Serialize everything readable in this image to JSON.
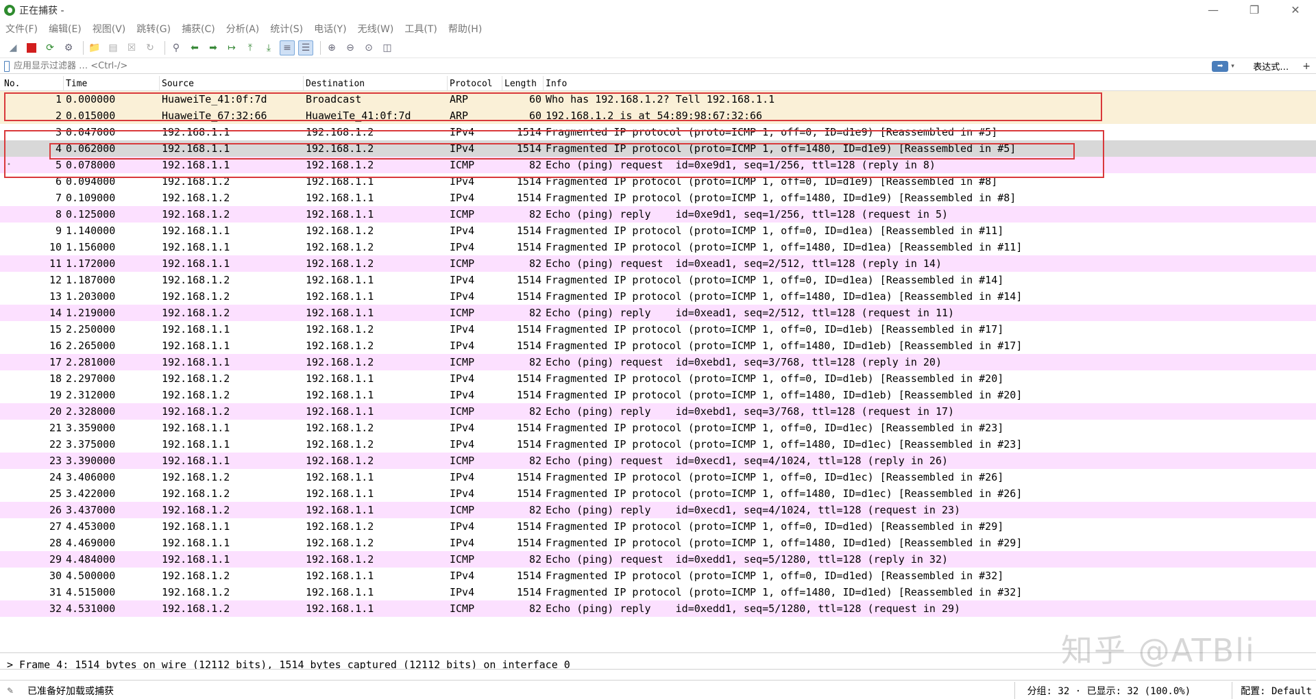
{
  "window": {
    "title": "正在捕获 -"
  },
  "menu": [
    "文件(F)",
    "编辑(E)",
    "视图(V)",
    "跳转(G)",
    "捕获(C)",
    "分析(A)",
    "统计(S)",
    "电话(Y)",
    "无线(W)",
    "工具(T)",
    "帮助(H)"
  ],
  "toolbar": {
    "icons": [
      "shark-fin-icon",
      "stop-icon",
      "restart-icon",
      "options-gear-icon",
      "open-folder-icon",
      "save-icon",
      "close-file-icon",
      "reload-icon",
      "find-icon",
      "back-arrow-icon",
      "forward-arrow-icon",
      "goto-packet-icon",
      "first-packet-icon",
      "last-packet-icon",
      "autoscroll-icon",
      "colorize-icon",
      "zoom-in-icon",
      "zoom-out-icon",
      "zoom-normal-icon",
      "resize-columns-icon"
    ]
  },
  "filter": {
    "placeholder": "应用显示过滤器 … <Ctrl-/>",
    "apply_arrow": "➡",
    "dropdown": "▾",
    "expression_label": "表达式…",
    "add_label": "+"
  },
  "columns": {
    "no": "No.",
    "time": "Time",
    "source": "Source",
    "destination": "Destination",
    "protocol": "Protocol",
    "length": "Length",
    "info": "Info"
  },
  "colors": {
    "arp": "#faf0d7",
    "icmp": "#fce0ff",
    "ipv4": "#ffffff",
    "selected": "#d8d8d8",
    "highlight_box": "#d9383a"
  },
  "packets": [
    {
      "no": "1",
      "time": "0.000000",
      "src": "HuaweiTe_41:0f:7d",
      "dst": "Broadcast",
      "proto": "ARP",
      "len": "60",
      "info": "Who has 192.168.1.2? Tell 192.168.1.1",
      "kind": "arp"
    },
    {
      "no": "2",
      "time": "0.015000",
      "src": "HuaweiTe_67:32:66",
      "dst": "HuaweiTe_41:0f:7d",
      "proto": "ARP",
      "len": "60",
      "info": "192.168.1.2 is at 54:89:98:67:32:66",
      "kind": "arp"
    },
    {
      "no": "3",
      "time": "0.047000",
      "src": "192.168.1.1",
      "dst": "192.168.1.2",
      "proto": "IPv4",
      "len": "1514",
      "info": "Fragmented IP protocol (proto=ICMP 1, off=0, ID=d1e9) [Reassembled in #5]",
      "kind": "ipv4"
    },
    {
      "no": "4",
      "time": "0.062000",
      "src": "192.168.1.1",
      "dst": "192.168.1.2",
      "proto": "IPv4",
      "len": "1514",
      "info": "Fragmented IP protocol (proto=ICMP 1, off=1480, ID=d1e9) [Reassembled in #5]",
      "kind": "selected"
    },
    {
      "no": "5",
      "time": "0.078000",
      "src": "192.168.1.1",
      "dst": "192.168.1.2",
      "proto": "ICMP",
      "len": "82",
      "info": "Echo (ping) request  id=0xe9d1, seq=1/256, ttl=128 (reply in 8)",
      "kind": "icmp"
    },
    {
      "no": "6",
      "time": "0.094000",
      "src": "192.168.1.2",
      "dst": "192.168.1.1",
      "proto": "IPv4",
      "len": "1514",
      "info": "Fragmented IP protocol (proto=ICMP 1, off=0, ID=d1e9) [Reassembled in #8]",
      "kind": "ipv4"
    },
    {
      "no": "7",
      "time": "0.109000",
      "src": "192.168.1.2",
      "dst": "192.168.1.1",
      "proto": "IPv4",
      "len": "1514",
      "info": "Fragmented IP protocol (proto=ICMP 1, off=1480, ID=d1e9) [Reassembled in #8]",
      "kind": "ipv4"
    },
    {
      "no": "8",
      "time": "0.125000",
      "src": "192.168.1.2",
      "dst": "192.168.1.1",
      "proto": "ICMP",
      "len": "82",
      "info": "Echo (ping) reply    id=0xe9d1, seq=1/256, ttl=128 (request in 5)",
      "kind": "icmp"
    },
    {
      "no": "9",
      "time": "1.140000",
      "src": "192.168.1.1",
      "dst": "192.168.1.2",
      "proto": "IPv4",
      "len": "1514",
      "info": "Fragmented IP protocol (proto=ICMP 1, off=0, ID=d1ea) [Reassembled in #11]",
      "kind": "ipv4"
    },
    {
      "no": "10",
      "time": "1.156000",
      "src": "192.168.1.1",
      "dst": "192.168.1.2",
      "proto": "IPv4",
      "len": "1514",
      "info": "Fragmented IP protocol (proto=ICMP 1, off=1480, ID=d1ea) [Reassembled in #11]",
      "kind": "ipv4"
    },
    {
      "no": "11",
      "time": "1.172000",
      "src": "192.168.1.1",
      "dst": "192.168.1.2",
      "proto": "ICMP",
      "len": "82",
      "info": "Echo (ping) request  id=0xead1, seq=2/512, ttl=128 (reply in 14)",
      "kind": "icmp"
    },
    {
      "no": "12",
      "time": "1.187000",
      "src": "192.168.1.2",
      "dst": "192.168.1.1",
      "proto": "IPv4",
      "len": "1514",
      "info": "Fragmented IP protocol (proto=ICMP 1, off=0, ID=d1ea) [Reassembled in #14]",
      "kind": "ipv4"
    },
    {
      "no": "13",
      "time": "1.203000",
      "src": "192.168.1.2",
      "dst": "192.168.1.1",
      "proto": "IPv4",
      "len": "1514",
      "info": "Fragmented IP protocol (proto=ICMP 1, off=1480, ID=d1ea) [Reassembled in #14]",
      "kind": "ipv4"
    },
    {
      "no": "14",
      "time": "1.219000",
      "src": "192.168.1.2",
      "dst": "192.168.1.1",
      "proto": "ICMP",
      "len": "82",
      "info": "Echo (ping) reply    id=0xead1, seq=2/512, ttl=128 (request in 11)",
      "kind": "icmp"
    },
    {
      "no": "15",
      "time": "2.250000",
      "src": "192.168.1.1",
      "dst": "192.168.1.2",
      "proto": "IPv4",
      "len": "1514",
      "info": "Fragmented IP protocol (proto=ICMP 1, off=0, ID=d1eb) [Reassembled in #17]",
      "kind": "ipv4"
    },
    {
      "no": "16",
      "time": "2.265000",
      "src": "192.168.1.1",
      "dst": "192.168.1.2",
      "proto": "IPv4",
      "len": "1514",
      "info": "Fragmented IP protocol (proto=ICMP 1, off=1480, ID=d1eb) [Reassembled in #17]",
      "kind": "ipv4"
    },
    {
      "no": "17",
      "time": "2.281000",
      "src": "192.168.1.1",
      "dst": "192.168.1.2",
      "proto": "ICMP",
      "len": "82",
      "info": "Echo (ping) request  id=0xebd1, seq=3/768, ttl=128 (reply in 20)",
      "kind": "icmp"
    },
    {
      "no": "18",
      "time": "2.297000",
      "src": "192.168.1.2",
      "dst": "192.168.1.1",
      "proto": "IPv4",
      "len": "1514",
      "info": "Fragmented IP protocol (proto=ICMP 1, off=0, ID=d1eb) [Reassembled in #20]",
      "kind": "ipv4"
    },
    {
      "no": "19",
      "time": "2.312000",
      "src": "192.168.1.2",
      "dst": "192.168.1.1",
      "proto": "IPv4",
      "len": "1514",
      "info": "Fragmented IP protocol (proto=ICMP 1, off=1480, ID=d1eb) [Reassembled in #20]",
      "kind": "ipv4"
    },
    {
      "no": "20",
      "time": "2.328000",
      "src": "192.168.1.2",
      "dst": "192.168.1.1",
      "proto": "ICMP",
      "len": "82",
      "info": "Echo (ping) reply    id=0xebd1, seq=3/768, ttl=128 (request in 17)",
      "kind": "icmp"
    },
    {
      "no": "21",
      "time": "3.359000",
      "src": "192.168.1.1",
      "dst": "192.168.1.2",
      "proto": "IPv4",
      "len": "1514",
      "info": "Fragmented IP protocol (proto=ICMP 1, off=0, ID=d1ec) [Reassembled in #23]",
      "kind": "ipv4"
    },
    {
      "no": "22",
      "time": "3.375000",
      "src": "192.168.1.1",
      "dst": "192.168.1.2",
      "proto": "IPv4",
      "len": "1514",
      "info": "Fragmented IP protocol (proto=ICMP 1, off=1480, ID=d1ec) [Reassembled in #23]",
      "kind": "ipv4"
    },
    {
      "no": "23",
      "time": "3.390000",
      "src": "192.168.1.1",
      "dst": "192.168.1.2",
      "proto": "ICMP",
      "len": "82",
      "info": "Echo (ping) request  id=0xecd1, seq=4/1024, ttl=128 (reply in 26)",
      "kind": "icmp"
    },
    {
      "no": "24",
      "time": "3.406000",
      "src": "192.168.1.2",
      "dst": "192.168.1.1",
      "proto": "IPv4",
      "len": "1514",
      "info": "Fragmented IP protocol (proto=ICMP 1, off=0, ID=d1ec) [Reassembled in #26]",
      "kind": "ipv4"
    },
    {
      "no": "25",
      "time": "3.422000",
      "src": "192.168.1.2",
      "dst": "192.168.1.1",
      "proto": "IPv4",
      "len": "1514",
      "info": "Fragmented IP protocol (proto=ICMP 1, off=1480, ID=d1ec) [Reassembled in #26]",
      "kind": "ipv4"
    },
    {
      "no": "26",
      "time": "3.437000",
      "src": "192.168.1.2",
      "dst": "192.168.1.1",
      "proto": "ICMP",
      "len": "82",
      "info": "Echo (ping) reply    id=0xecd1, seq=4/1024, ttl=128 (request in 23)",
      "kind": "icmp"
    },
    {
      "no": "27",
      "time": "4.453000",
      "src": "192.168.1.1",
      "dst": "192.168.1.2",
      "proto": "IPv4",
      "len": "1514",
      "info": "Fragmented IP protocol (proto=ICMP 1, off=0, ID=d1ed) [Reassembled in #29]",
      "kind": "ipv4"
    },
    {
      "no": "28",
      "time": "4.469000",
      "src": "192.168.1.1",
      "dst": "192.168.1.2",
      "proto": "IPv4",
      "len": "1514",
      "info": "Fragmented IP protocol (proto=ICMP 1, off=1480, ID=d1ed) [Reassembled in #29]",
      "kind": "ipv4"
    },
    {
      "no": "29",
      "time": "4.484000",
      "src": "192.168.1.1",
      "dst": "192.168.1.2",
      "proto": "ICMP",
      "len": "82",
      "info": "Echo (ping) request  id=0xedd1, seq=5/1280, ttl=128 (reply in 32)",
      "kind": "icmp"
    },
    {
      "no": "30",
      "time": "4.500000",
      "src": "192.168.1.2",
      "dst": "192.168.1.1",
      "proto": "IPv4",
      "len": "1514",
      "info": "Fragmented IP protocol (proto=ICMP 1, off=0, ID=d1ed) [Reassembled in #32]",
      "kind": "ipv4"
    },
    {
      "no": "31",
      "time": "4.515000",
      "src": "192.168.1.2",
      "dst": "192.168.1.1",
      "proto": "IPv4",
      "len": "1514",
      "info": "Fragmented IP protocol (proto=ICMP 1, off=1480, ID=d1ed) [Reassembled in #32]",
      "kind": "ipv4"
    },
    {
      "no": "32",
      "time": "4.531000",
      "src": "192.168.1.2",
      "dst": "192.168.1.1",
      "proto": "ICMP",
      "len": "82",
      "info": "Echo (ping) reply    id=0xedd1, seq=5/1280, ttl=128 (request in 29)",
      "kind": "icmp"
    }
  ],
  "detail": {
    "line": "> Frame 4: 1514 bytes on wire (12112 bits), 1514 bytes captured (12112 bits) on interface 0"
  },
  "status": {
    "message": "已准备好加载或捕获",
    "packets": "分组: 32 · 已显示: 32 (100.0%)",
    "profile": "配置: Default"
  },
  "watermark": "知乎 @ATBli"
}
